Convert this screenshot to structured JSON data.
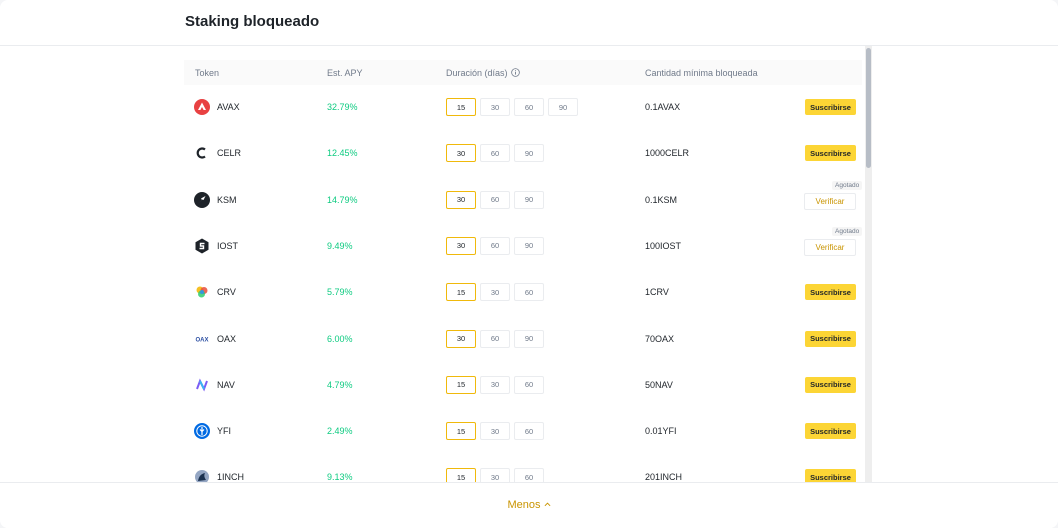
{
  "title": "Staking bloqueado",
  "columns": {
    "token": "Token",
    "apy": "Est. APY",
    "duration": "Duración (días)",
    "min": "Cantidad mínima bloqueada"
  },
  "colors": {
    "accent": "#fcd535",
    "accent_text": "#c99400",
    "apy_green": "#0ecb81"
  },
  "rows": [
    {
      "token": "AVAX",
      "icon": "avax-icon",
      "apy": "32.79%",
      "durations": [
        "15",
        "30",
        "60",
        "90"
      ],
      "min": "0.1AVAX",
      "action": "subscribe",
      "button": "Suscribirse"
    },
    {
      "token": "CELR",
      "icon": "celr-icon",
      "apy": "12.45%",
      "durations": [
        "30",
        "60",
        "90"
      ],
      "min": "1000CELR",
      "action": "subscribe",
      "button": "Suscribirse"
    },
    {
      "token": "KSM",
      "icon": "ksm-icon",
      "apy": "14.79%",
      "durations": [
        "30",
        "60",
        "90"
      ],
      "min": "0.1KSM",
      "action": "verify",
      "button": "Verificar",
      "tag": "Agotado"
    },
    {
      "token": "IOST",
      "icon": "iost-icon",
      "apy": "9.49%",
      "durations": [
        "30",
        "60",
        "90"
      ],
      "min": "100IOST",
      "action": "verify",
      "button": "Verificar",
      "tag": "Agotado"
    },
    {
      "token": "CRV",
      "icon": "crv-icon",
      "apy": "5.79%",
      "durations": [
        "15",
        "30",
        "60"
      ],
      "min": "1CRV",
      "action": "subscribe",
      "button": "Suscribirse"
    },
    {
      "token": "OAX",
      "icon": "oax-icon",
      "apy": "6.00%",
      "durations": [
        "30",
        "60",
        "90"
      ],
      "min": "70OAX",
      "action": "subscribe",
      "button": "Suscribirse"
    },
    {
      "token": "NAV",
      "icon": "nav-icon",
      "apy": "4.79%",
      "durations": [
        "15",
        "30",
        "60"
      ],
      "min": "50NAV",
      "action": "subscribe",
      "button": "Suscribirse"
    },
    {
      "token": "YFI",
      "icon": "yfi-icon",
      "apy": "2.49%",
      "durations": [
        "15",
        "30",
        "60"
      ],
      "min": "0.01YFI",
      "action": "subscribe",
      "button": "Suscribirse"
    },
    {
      "token": "1INCH",
      "icon": "1inch-icon",
      "apy": "9.13%",
      "durations": [
        "15",
        "30",
        "60"
      ],
      "min": "201INCH",
      "action": "subscribe",
      "button": "Suscribirse"
    }
  ],
  "footer": {
    "less_label": "Menos"
  }
}
